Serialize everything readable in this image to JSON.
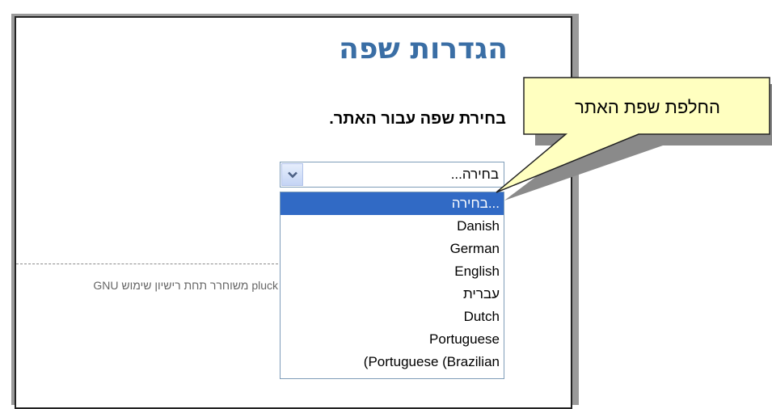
{
  "page": {
    "title": "הגדרות שפה",
    "section_heading": "בחירת שפה עבור האתר.",
    "footer_text": "pluck משוחרר תחת רישיון שימוש GNU"
  },
  "language_select": {
    "current_value": "בחירה...",
    "options": [
      "בחירה...",
      "Danish",
      "German",
      "English",
      "עברית",
      "Dutch",
      "Portuguese",
      "(Portuguese (Brazilian"
    ],
    "highlighted_index": 0
  },
  "callout": {
    "text": "החלפת שפת האתר"
  },
  "colors": {
    "title": "#3a6ea5",
    "highlight": "#316ac5",
    "callout_fill": "#ffffc0"
  },
  "icons": {
    "select_arrow": "chevron-down-icon"
  }
}
